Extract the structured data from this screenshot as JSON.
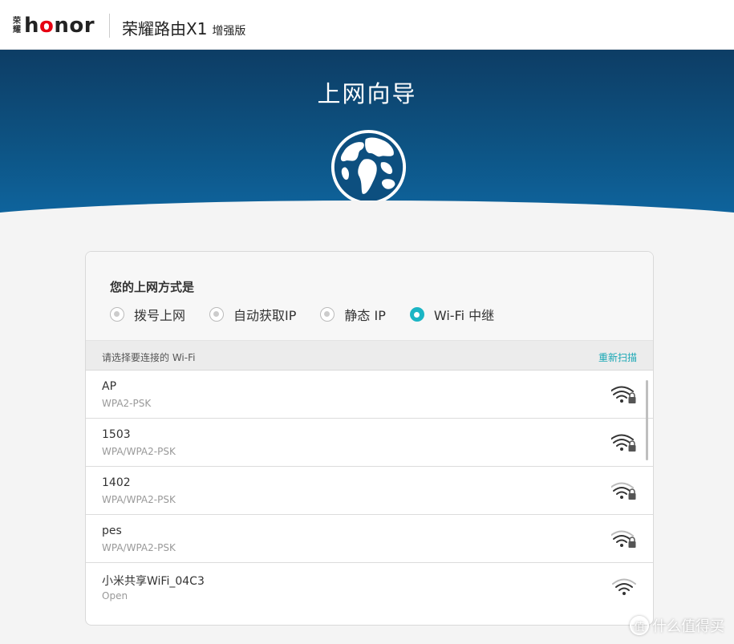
{
  "header": {
    "logo_cn": "荣耀",
    "logo_en": "honor",
    "product_name": "荣耀路由X1",
    "product_edition": "增强版"
  },
  "hero": {
    "title": "上网向导",
    "icon": "globe-icon"
  },
  "connection_type": {
    "question": "您的上网方式是",
    "options": [
      {
        "label": "拨号上网",
        "selected": false
      },
      {
        "label": "自动获取IP",
        "selected": false
      },
      {
        "label": "静态 IP",
        "selected": false
      },
      {
        "label": "Wi-Fi 中继",
        "selected": true
      }
    ]
  },
  "wifi_list": {
    "header": "请选择要连接的 Wi-Fi",
    "rescan_label": "重新扫描",
    "networks": [
      {
        "ssid": "AP",
        "security": "WPA2-PSK",
        "signal_bars": 3,
        "locked": true
      },
      {
        "ssid": "1503",
        "security": "WPA/WPA2-PSK",
        "signal_bars": 3,
        "locked": true
      },
      {
        "ssid": "1402",
        "security": "WPA/WPA2-PSK",
        "signal_bars": 2,
        "locked": true
      },
      {
        "ssid": "pes",
        "security": "WPA/WPA2-PSK",
        "signal_bars": 2,
        "locked": true
      },
      {
        "ssid": "小米共享WiFi_04C3",
        "security": "Open",
        "signal_bars": 2,
        "locked": false
      }
    ]
  },
  "watermark": {
    "icon": "值",
    "text": "什么值得买"
  },
  "colors": {
    "accent": "#1bb5c4",
    "link": "#1aa7b5",
    "hero_top": "#0d3d65",
    "hero_bottom": "#0e66a0",
    "brand_red": "#e60012"
  }
}
